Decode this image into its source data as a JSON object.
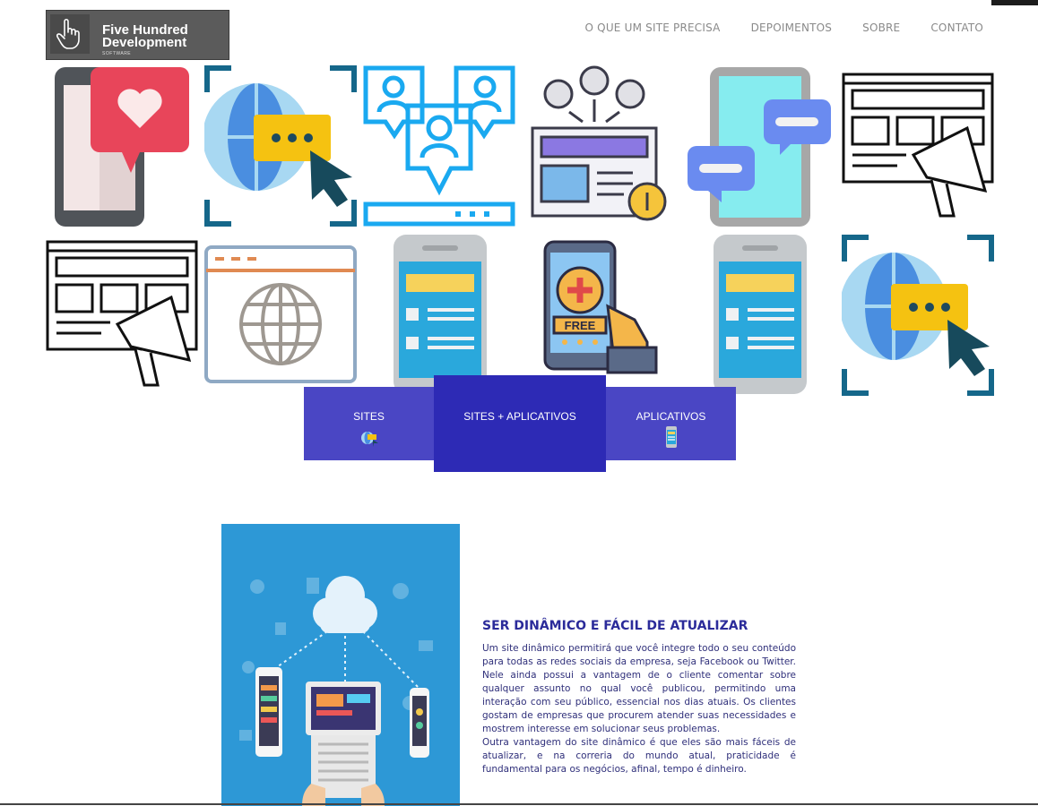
{
  "brand": {
    "name_line1": "Five Hundred",
    "name_line2": "Development",
    "tagline": "SOFTWARE"
  },
  "nav": {
    "items": [
      "O QUE UM SITE PRECISA",
      "DEPOIMENTOS",
      "SOBRE",
      "CONTATO"
    ]
  },
  "tabs": {
    "sites": "SITES",
    "both": "SITES + APLICATIVOS",
    "apps": "APLICATIVOS"
  },
  "icons": {
    "free_badge": "FREE"
  },
  "section": {
    "title": "SER DINÂMICO E FÁCIL DE ATUALIZAR",
    "paragraph1": "Um site dinâmico permitirá que você integre todo o seu conteúdo para todas as redes sociais da empresa, seja Facebook ou Twitter. Nele ainda possui a vantagem de o cliente comentar sobre qualquer assunto no qual você publicou, permitindo uma interação com seu público, essencial nos dias atuais. Os clientes gostam de empresas que procurem atender suas necessidades e mostrem interesse em solucionar seus problemas.",
    "paragraph2": "Outra vantagem do site dinâmico é que eles são mais fáceis de atualizar, e na correria do mundo atual, praticidade é fundamental para os negócios, afinal, tempo é dinheiro."
  },
  "colors": {
    "tab": "#4a46c4",
    "tab_active": "#2d2ab5",
    "title": "#2b2b9a",
    "nav": "#8a8a8a"
  }
}
